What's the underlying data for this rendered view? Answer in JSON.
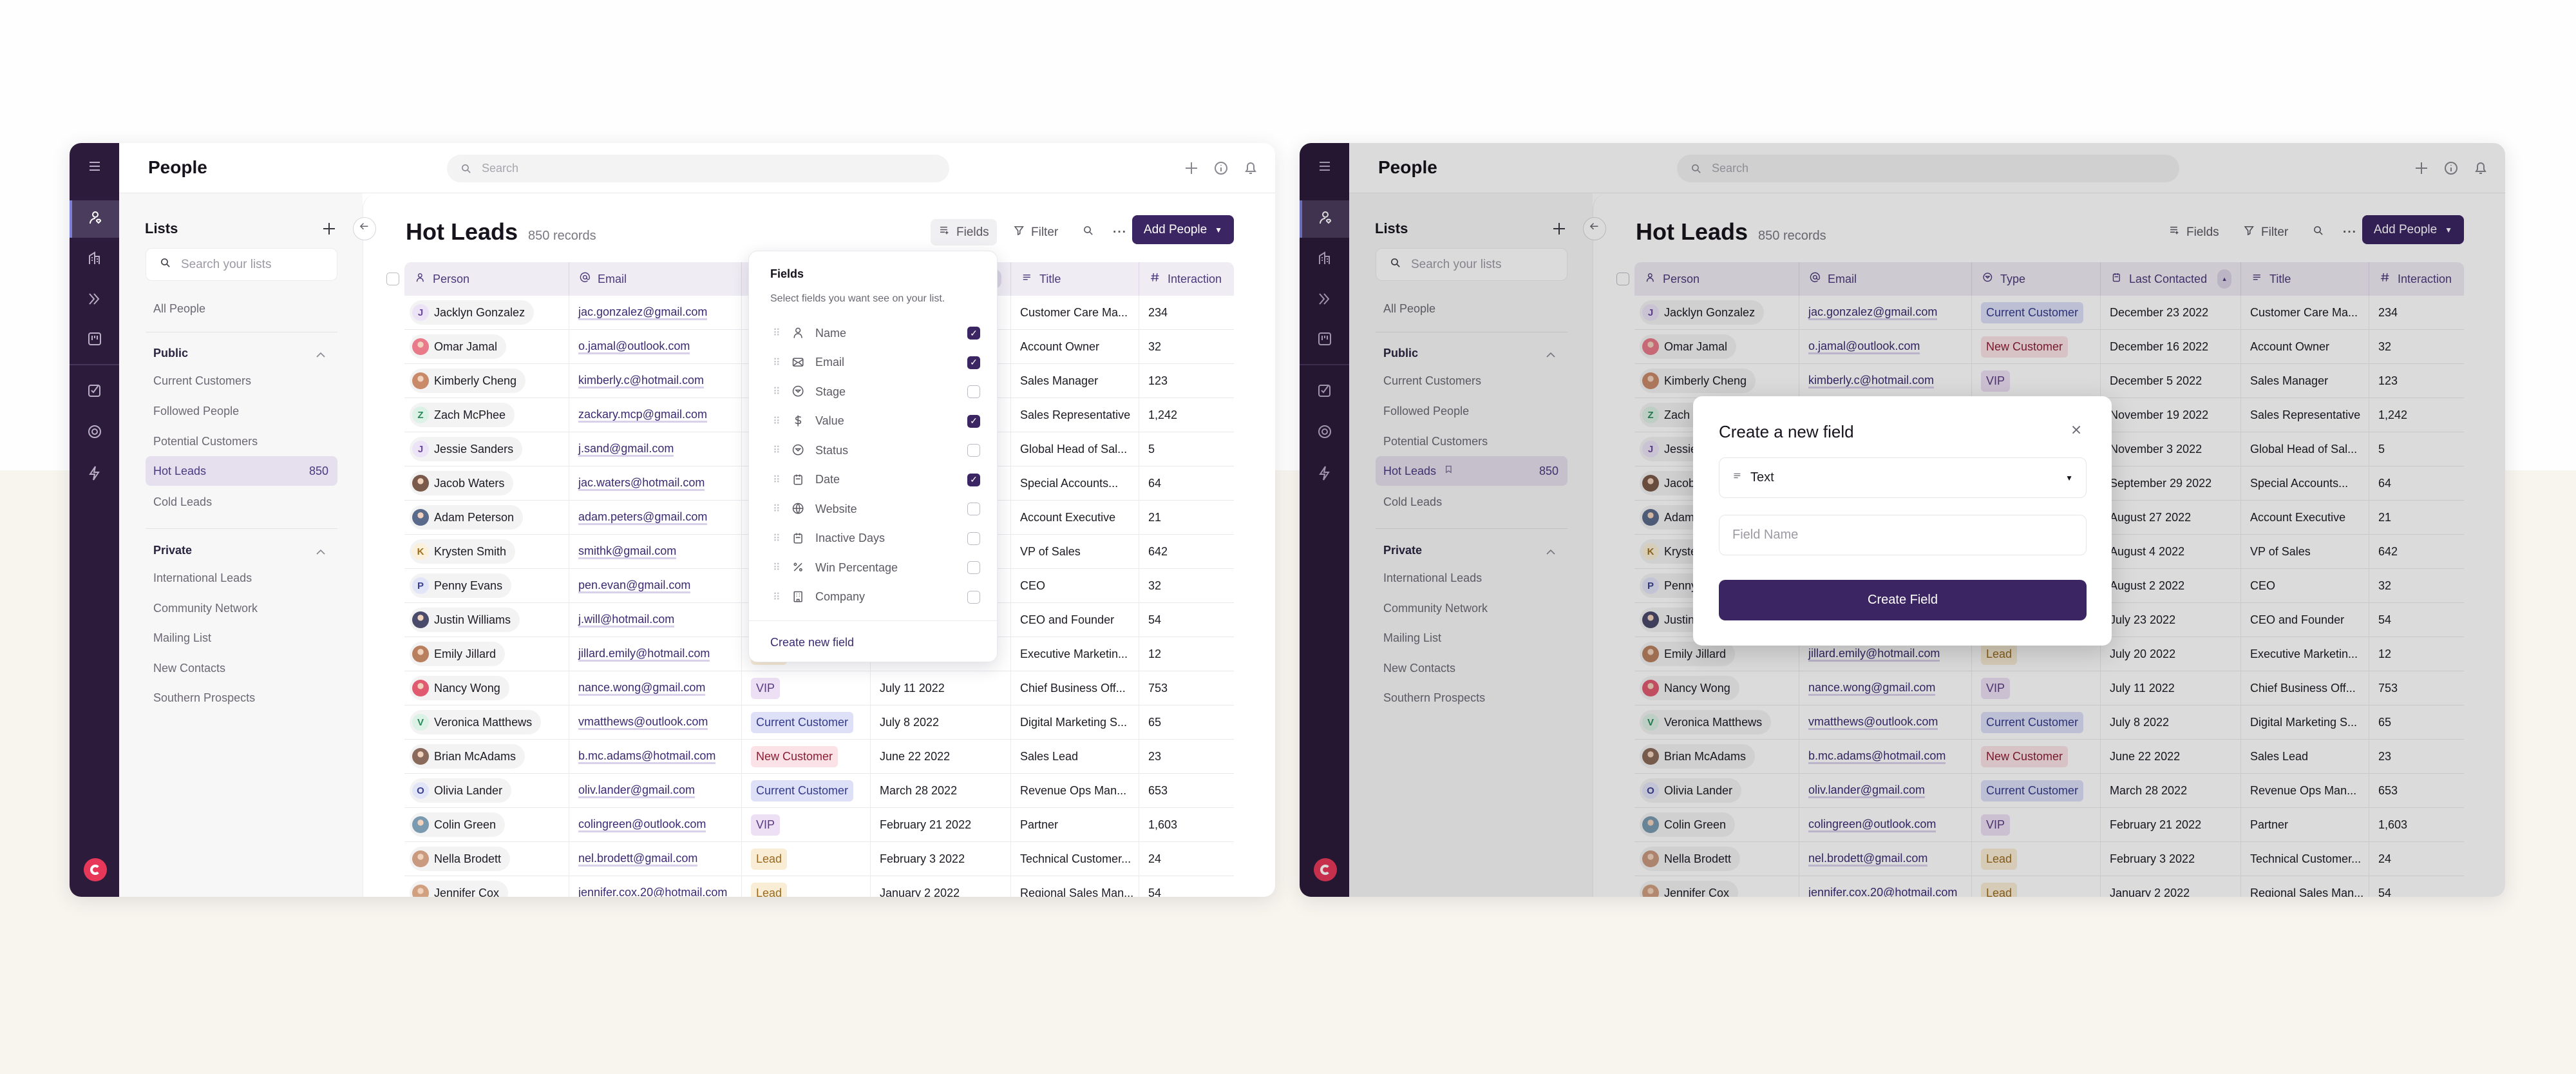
{
  "app": {
    "title": "People",
    "search_placeholder": "Search"
  },
  "lists": {
    "title": "Lists",
    "search_placeholder": "Search your lists",
    "all": "All People",
    "public": {
      "label": "Public",
      "items": [
        "Current Customers",
        "Followed People",
        "Potential Customers",
        "Hot Leads",
        "Cold Leads"
      ]
    },
    "active_count": "850",
    "private": {
      "label": "Private",
      "items": [
        "International Leads",
        "Community Network",
        "Mailing List",
        "New Contacts",
        "Southern Prospects"
      ]
    }
  },
  "main": {
    "title": "Hot Leads",
    "records": "850 records",
    "fields": "Fields",
    "filter": "Filter",
    "add": "Add People"
  },
  "table": {
    "columns": [
      {
        "label": "Person",
        "icon": "person-icon"
      },
      {
        "label": "Email",
        "icon": "at-icon"
      },
      {
        "label": "Type",
        "icon": "circle-dropdown-icon"
      },
      {
        "label": "Last Contacted",
        "icon": "calendar-icon"
      },
      {
        "label": "Title",
        "icon": "text-lines-icon"
      },
      {
        "label": "Interaction",
        "icon": "hash-icon"
      }
    ],
    "rows": [
      {
        "name": "Jacklyn Gonzalez",
        "avatar": "J",
        "email": "jac.gonzalez@gmail.com",
        "type": "Current Customer",
        "date": "December 23 2022",
        "title": "Customer Care Ma...",
        "interaction": "234"
      },
      {
        "name": "Omar Jamal",
        "avatar": "",
        "email": "o.jamal@outlook.com",
        "type": "New Customer",
        "date": "December 16 2022",
        "title": "Account Owner",
        "interaction": "32"
      },
      {
        "name": "Kimberly Cheng",
        "avatar": "",
        "email": "kimberly.c@hotmail.com",
        "type": "VIP",
        "date": "December 5 2022",
        "title": "Sales Manager",
        "interaction": "123"
      },
      {
        "name": "Zach McPhee",
        "avatar": "Z",
        "email": "zackary.mcp@gmail.com",
        "type": "",
        "date": "November 19 2022",
        "title": "Sales Representative",
        "interaction": "1,242"
      },
      {
        "name": "Jessie Sanders",
        "avatar": "J",
        "email": "j.sand@gmail.com",
        "type": "",
        "date": "November 3 2022",
        "title": "Global Head of Sal...",
        "interaction": "5"
      },
      {
        "name": "Jacob Waters",
        "avatar": "",
        "email": "jac.waters@hotmail.com",
        "type": "",
        "date": "September 29 2022",
        "title": "Special Accounts...",
        "interaction": "64"
      },
      {
        "name": "Adam Peterson",
        "avatar": "",
        "email": "adam.peters@gmail.com",
        "type": "",
        "date": "August 27 2022",
        "title": "Account Executive",
        "interaction": "21"
      },
      {
        "name": "Krysten Smith",
        "avatar": "K",
        "email": "smithk@gmail.com",
        "type": "",
        "date": "August 4 2022",
        "title": "VP of Sales",
        "interaction": "642"
      },
      {
        "name": "Penny Evans",
        "avatar": "P",
        "email": "pen.evan@gmail.com",
        "type": "",
        "date": "August 2 2022",
        "title": "CEO",
        "interaction": "32"
      },
      {
        "name": "Justin Williams",
        "avatar": "",
        "email": "j.will@hotmail.com",
        "type": "",
        "date": "July 23 2022",
        "title": "CEO and Founder",
        "interaction": "54"
      },
      {
        "name": "Emily Jillard",
        "avatar": "",
        "email": "jillard.emily@hotmail.com",
        "type": "Lead",
        "date": "July 20 2022",
        "title": "Executive Marketin...",
        "interaction": "12"
      },
      {
        "name": "Nancy Wong",
        "avatar": "",
        "email": "nance.wong@gmail.com",
        "type": "VIP",
        "date": "July 11 2022",
        "title": "Chief Business Off...",
        "interaction": "753"
      },
      {
        "name": "Veronica Matthews",
        "avatar": "V",
        "email": "vmatthews@outlook.com",
        "type": "Current Customer",
        "date": "July 8 2022",
        "title": "Digital Marketing S...",
        "interaction": "65"
      },
      {
        "name": "Brian McAdams",
        "avatar": "",
        "email": "b.mc.adams@hotmail.com",
        "type": "New Customer",
        "date": "June 22 2022",
        "title": "Sales Lead",
        "interaction": "23"
      },
      {
        "name": "Olivia Lander",
        "avatar": "O",
        "email": "oliv.lander@gmail.com",
        "type": "Current Customer",
        "date": "March 28 2022",
        "title": "Revenue Ops Man...",
        "interaction": "653"
      },
      {
        "name": "Colin Green",
        "avatar": "",
        "email": "colingreen@outlook.com",
        "type": "VIP",
        "date": "February 21 2022",
        "title": "Partner",
        "interaction": "1,603"
      },
      {
        "name": "Nella Brodett",
        "avatar": "",
        "email": "nel.brodett@gmail.com",
        "type": "Lead",
        "date": "February 3 2022",
        "title": "Technical Customer...",
        "interaction": "24"
      },
      {
        "name": "Jennifer Cox",
        "avatar": "",
        "email": "jennifer.cox.20@hotmail.com",
        "type": "Lead",
        "date": "January 2 2022",
        "title": "Regional Sales Man...",
        "interaction": "54"
      }
    ]
  },
  "fields_popup": {
    "title": "Fields",
    "subtitle": "Select fields you want see on your list.",
    "items": [
      {
        "label": "Name",
        "icon": "person-icon",
        "checked": true
      },
      {
        "label": "Email",
        "icon": "mail-icon",
        "checked": true
      },
      {
        "label": "Stage",
        "icon": "circle-dropdown-icon",
        "checked": false
      },
      {
        "label": "Value",
        "icon": "dollar-icon",
        "checked": true
      },
      {
        "label": "Status",
        "icon": "circle-dropdown-icon",
        "checked": false
      },
      {
        "label": "Date",
        "icon": "calendar-icon",
        "checked": true
      },
      {
        "label": "Website",
        "icon": "globe-icon",
        "checked": false
      },
      {
        "label": "Inactive Days",
        "icon": "calendar-icon",
        "checked": false
      },
      {
        "label": "Win Percentage",
        "icon": "percent-icon",
        "checked": false
      },
      {
        "label": "Company",
        "icon": "building-icon",
        "checked": false
      }
    ],
    "create": "Create new field"
  },
  "modal": {
    "title": "Create a new field",
    "type_value": "Text",
    "name_placeholder": "Field Name",
    "submit": "Create Field"
  },
  "colors": {
    "rail": "#2c1b3b",
    "accent": "#3b2562",
    "type_styles": {
      "Current Customer": {
        "bg": "#dde0f7",
        "fg": "#333a8a"
      },
      "New Customer": {
        "bg": "#fbe2e6",
        "fg": "#8b1e34"
      },
      "VIP": {
        "bg": "#ede0f5",
        "fg": "#5a3a80"
      },
      "Lead": {
        "bg": "#f9edd6",
        "fg": "#9a6a1e"
      }
    }
  }
}
